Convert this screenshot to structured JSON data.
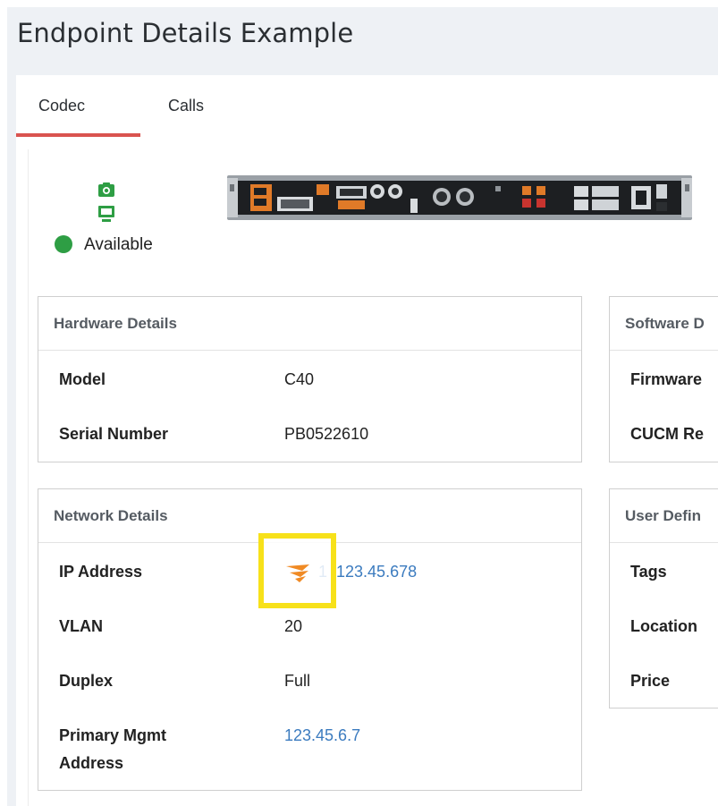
{
  "page": {
    "title": "Endpoint Details Example"
  },
  "tabs": [
    {
      "label": "Codec",
      "active": true
    },
    {
      "label": "Calls",
      "active": false
    }
  ],
  "status": {
    "text": "Available",
    "icons": [
      "camera-icon",
      "monitor-icon"
    ],
    "color": "#2e9e44"
  },
  "hardware": {
    "title": "Hardware Details",
    "rows": [
      {
        "label": "Model",
        "value": "C40"
      },
      {
        "label": "Serial Number",
        "value": "PB0522610"
      }
    ]
  },
  "network": {
    "title": "Network Details",
    "rows": [
      {
        "label": "IP Address",
        "value": "1 .123.45.678"
      },
      {
        "label": "VLAN",
        "value": "20"
      },
      {
        "label": "Duplex",
        "value": "Full"
      },
      {
        "label": "Primary Mgmt Address",
        "value": "123.45.6.7"
      }
    ]
  },
  "software": {
    "title": "Software D",
    "rows": [
      {
        "label": "Firmware"
      },
      {
        "label": "CUCM Re"
      }
    ]
  },
  "user_defined": {
    "title": "User Defin",
    "rows": [
      {
        "label": "Tags"
      },
      {
        "label": "Location"
      },
      {
        "label": "Price"
      }
    ]
  },
  "colors": {
    "accent": "#d9534f",
    "link": "#3b7bbf",
    "highlight": "#f7e11a",
    "status_icon": "#2e9e44",
    "orion_icon": "#f08a24"
  }
}
